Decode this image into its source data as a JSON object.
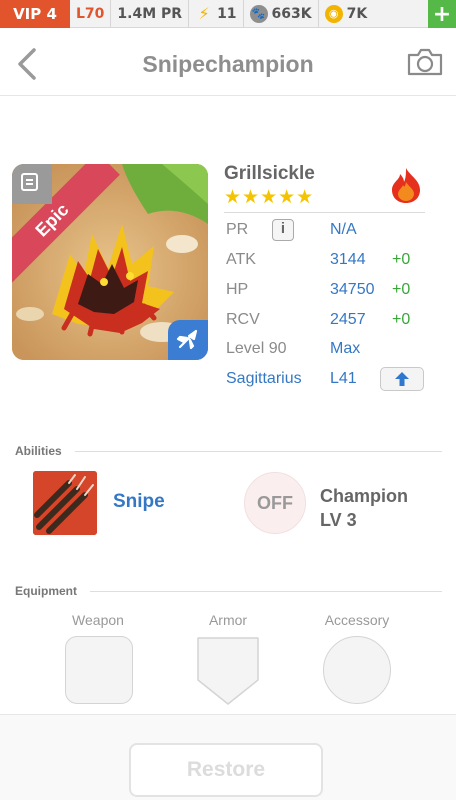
{
  "status_bar": {
    "vip": "VIP 4",
    "level": "L70",
    "power": "1.4M PR",
    "energy": "11",
    "paw": "663K",
    "coins": "7K",
    "add_icon": "plus-icon"
  },
  "header": {
    "title": "Snipechampion",
    "back_icon": "chevron-left-icon",
    "camera_icon": "camera-icon"
  },
  "monster": {
    "name": "Grillsickle",
    "rarity": "Epic",
    "stars": "★★★★★",
    "element_icon": "fire-icon",
    "class_icon": "plane-icon",
    "stats": {
      "pr_label": "PR",
      "pr_value": "N/A",
      "info_glyph": "i",
      "atk_label": "ATK",
      "atk_value": "3144",
      "atk_bonus": "+0",
      "hp_label": "HP",
      "hp_value": "34750",
      "hp_bonus": "+0",
      "rcv_label": "RCV",
      "rcv_value": "2457",
      "rcv_bonus": "+0",
      "level_label": "Level 90",
      "level_value": "Max",
      "constellation": "Sagittarius",
      "constellation_level": "L41"
    }
  },
  "abilities": {
    "label": "Abilities",
    "primary": "Snipe",
    "secondary_state": "OFF",
    "secondary_name": "Champion",
    "secondary_level": "LV 3"
  },
  "equipment": {
    "label": "Equipment",
    "slots": [
      "Weapon",
      "Armor",
      "Accessory"
    ]
  },
  "actions": {
    "restore_label": "Restore"
  },
  "colors": {
    "accent_blue": "#3478c5",
    "vip_orange": "#e2542c",
    "bonus_green": "#3aa63a",
    "star_gold": "#f5c400",
    "epic_red": "#d9485a"
  }
}
